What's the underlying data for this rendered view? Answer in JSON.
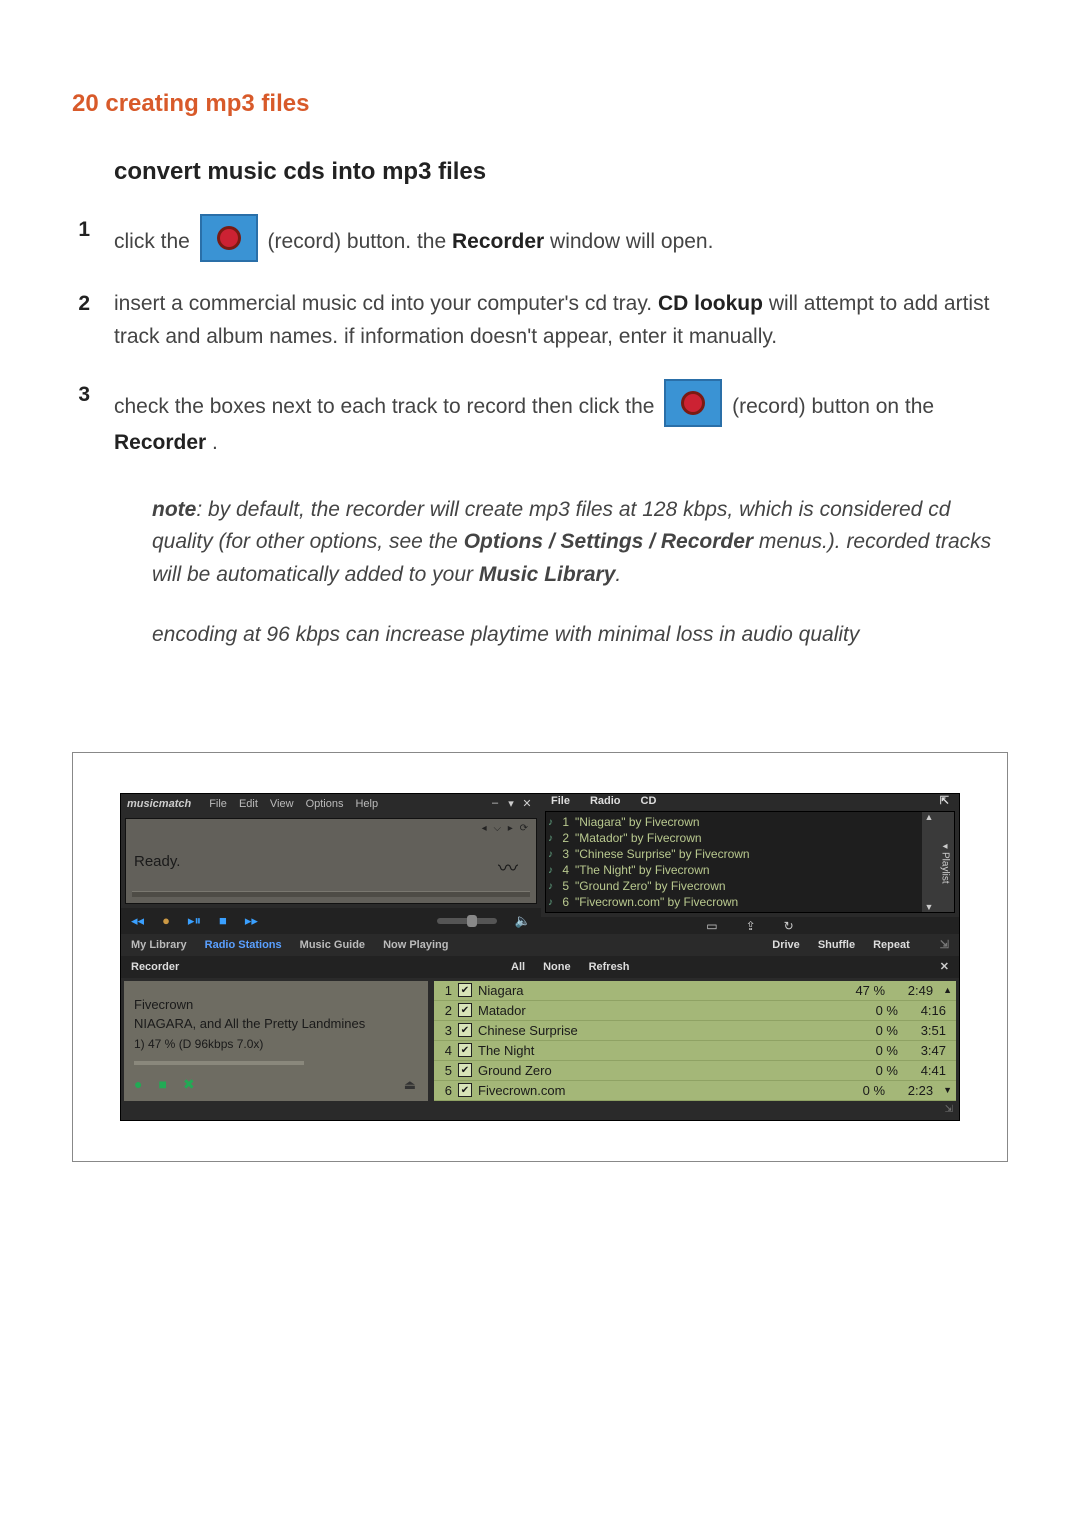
{
  "header": "20 creating mp3 files",
  "section_title": "convert music cds into mp3 files",
  "steps": {
    "s1": {
      "num": "1",
      "pre": "click the ",
      "post1": " (record) button. the ",
      "bold1": "Recorder",
      "post2": " window will open."
    },
    "s2": {
      "num": "2",
      "pre": "insert a commercial music cd into your computer's cd tray. ",
      "bold1": "CD lookup",
      "post1": " will attempt to add artist track and album names. if information doesn't appear, enter it manually."
    },
    "s3": {
      "num": "3",
      "pre": "check the boxes next to each track to record then click the ",
      "post1": " (record) button on the ",
      "bold1": "Recorder",
      "post2": "."
    }
  },
  "note": {
    "lead": "note",
    "p1a": ": by default, the recorder will create mp3 files at 128 kbps, which is considered cd quality (for other options, see the ",
    "b1": "Options / Settings / Recorder",
    "p1b": " menus.). recorded tracks will be automatically added to your ",
    "b2": "Music Library",
    "p1c": ".",
    "p2": "encoding at 96 kbps can increase playtime with minimal loss in audio quality"
  },
  "app": {
    "brand": "musicmatch",
    "menus": {
      "file": "File",
      "edit": "Edit",
      "view": "View",
      "options": "Options",
      "help": "Help"
    },
    "win": {
      "min": "–",
      "max": "▾",
      "close": "✕"
    },
    "display": {
      "status": "Ready.",
      "mini": "◂ ⌵ ▸     ⟳"
    },
    "playlist_header": {
      "file": "File",
      "radio": "Radio",
      "cd": "CD",
      "expand": "⇱"
    },
    "playlist_tab": "Playlist",
    "playlist": [
      {
        "n": "1",
        "title": "\"Niagara\" by Fivecrown"
      },
      {
        "n": "2",
        "title": "\"Matador\" by Fivecrown"
      },
      {
        "n": "3",
        "title": "\"Chinese Surprise\" by Fivecrown"
      },
      {
        "n": "4",
        "title": "\"The Night\" by Fivecrown"
      },
      {
        "n": "5",
        "title": "\"Ground Zero\" by Fivecrown"
      },
      {
        "n": "6",
        "title": "\"Fivecrown.com\" by Fivecrown"
      }
    ],
    "playlist_footer": {
      "a": "▭",
      "b": "⇪",
      "c": "↻"
    },
    "nav": {
      "lib": "My Library",
      "radio": "Radio Stations",
      "guide": "Music Guide",
      "now": "Now Playing",
      "drive": "Drive",
      "shuffle": "Shuffle",
      "repeat": "Repeat"
    },
    "recorder": {
      "title": "Recorder",
      "sel": {
        "all": "All",
        "none": "None",
        "refresh": "Refresh"
      },
      "close": "✕",
      "artist": "Fivecrown",
      "album": "NIAGARA, and All the Pretty Landmines",
      "progress": "1) 47 % (D 96kbps 7.0x)",
      "tracks": [
        {
          "n": "1",
          "name": "Niagara",
          "pct": "47 %",
          "dur": "2:49"
        },
        {
          "n": "2",
          "name": "Matador",
          "pct": "0 %",
          "dur": "4:16"
        },
        {
          "n": "3",
          "name": "Chinese Surprise",
          "pct": "0 %",
          "dur": "3:51"
        },
        {
          "n": "4",
          "name": "The Night",
          "pct": "0 %",
          "dur": "3:47"
        },
        {
          "n": "5",
          "name": "Ground Zero",
          "pct": "0 %",
          "dur": "4:41"
        },
        {
          "n": "6",
          "name": "Fivecrown.com",
          "pct": "0 %",
          "dur": "2:23"
        }
      ]
    }
  }
}
